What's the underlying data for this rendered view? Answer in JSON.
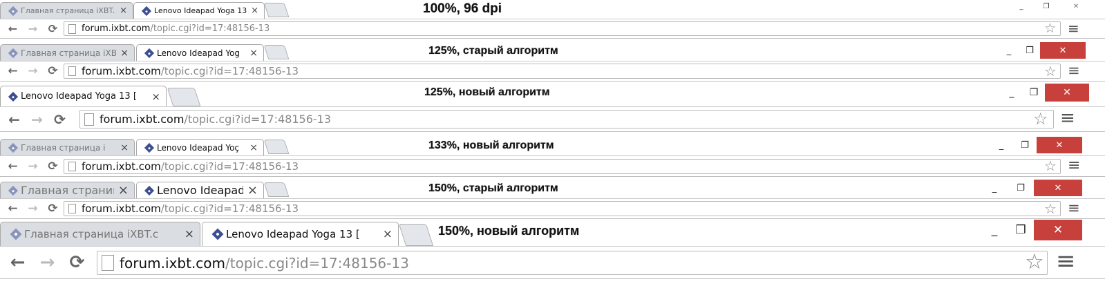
{
  "strips": [
    {
      "caption": "100%, 96 dpi",
      "tabs": [
        {
          "title": "Главная страница iXBT.c",
          "active": false,
          "icon": "ixbt-favicon-icon"
        },
        {
          "title": "Lenovo Ideapad Yoga 13 [",
          "active": true,
          "icon": "ixbt-favicon-icon"
        }
      ],
      "url_host": "forum.ixbt.com",
      "url_path": "/topic.cgi?id=17:48156-13",
      "window_close_style": "plain"
    },
    {
      "caption": "125%, старый алгоритм",
      "tabs": [
        {
          "title": "Главная страница iXB",
          "active": false,
          "icon": "ixbt-favicon-icon"
        },
        {
          "title": "Lenovo Ideapad Yog",
          "active": true,
          "icon": "ixbt-favicon-icon"
        }
      ],
      "url_host": "forum.ixbt.com",
      "url_path": "/topic.cgi?id=17:48156-13",
      "window_close_style": "red"
    },
    {
      "caption": "125%, новый алгоритм",
      "tabs": [
        {
          "title": "Lenovo Ideapad Yoga 13 [",
          "active": true,
          "icon": "ixbt-favicon-icon"
        }
      ],
      "url_host": "forum.ixbt.com",
      "url_path": "/topic.cgi?id=17:48156-13",
      "window_close_style": "red"
    },
    {
      "caption": "133%, новый алгоритм",
      "tabs": [
        {
          "title": "Главная страница i",
          "active": false,
          "icon": "ixbt-favicon-icon"
        },
        {
          "title": "Lenovo Ideapad Yoç",
          "active": true,
          "icon": "ixbt-favicon-icon"
        }
      ],
      "url_host": "forum.ixbt.com",
      "url_path": "/topic.cgi?id=17:48156-13",
      "window_close_style": "red"
    },
    {
      "caption": "150%, старый алгоритм",
      "tabs": [
        {
          "title": "Главная страниц",
          "active": false,
          "icon": "ixbt-favicon-icon"
        },
        {
          "title": "Lenovo Ideapad `",
          "active": true,
          "icon": "ixbt-favicon-icon"
        }
      ],
      "url_host": "forum.ixbt.com",
      "url_path": "/topic.cgi?id=17:48156-13",
      "window_close_style": "red"
    },
    {
      "caption": "150%, новый алгоритм",
      "tabs": [
        {
          "title": "Главная страница iXBT.c",
          "active": false,
          "icon": "ixbt-favicon-icon"
        },
        {
          "title": "Lenovo Ideapad Yoga 13 [",
          "active": true,
          "icon": "ixbt-favicon-icon"
        }
      ],
      "url_host": "forum.ixbt.com",
      "url_path": "/topic.cgi?id=17:48156-13",
      "window_close_style": "red"
    }
  ],
  "icons": {
    "back": "←",
    "forward": "→",
    "reload": "⟳",
    "star": "☆",
    "menu": "≡",
    "tab_close": "×",
    "minimize": "_",
    "maximize": "❐",
    "close": "✕"
  },
  "colors": {
    "close_button_red": "#c7403b",
    "url_host": "#111111",
    "url_path": "#888888"
  }
}
